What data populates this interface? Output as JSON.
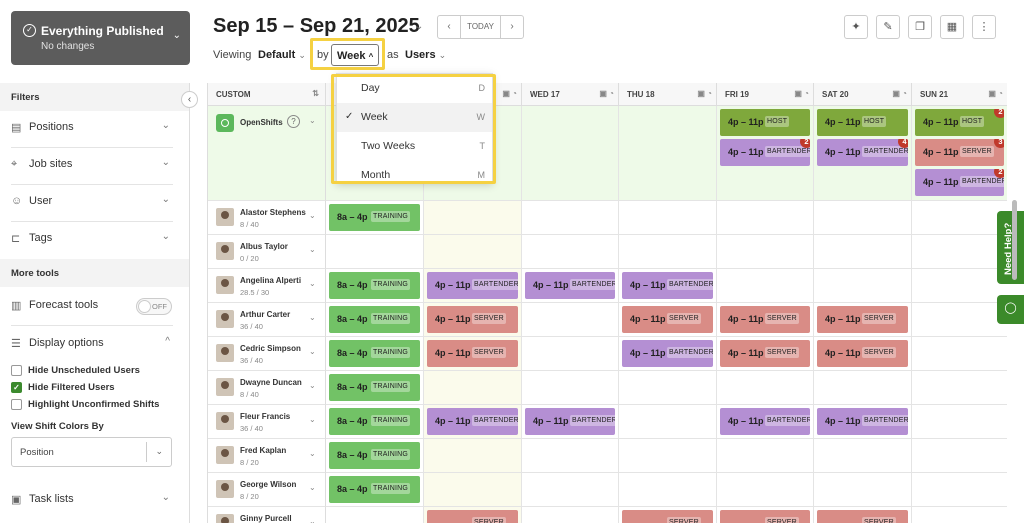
{
  "publish": {
    "title": "Everything Published",
    "subtitle": "No changes"
  },
  "header": {
    "date_range": "Sep 15 – Sep 21, 2025",
    "today_label": "TODAY",
    "prev_icon": "chevron-left-icon",
    "next_icon": "chevron-right-icon",
    "viewing_label": "Viewing",
    "viewing_value": "Default",
    "by_label": "by",
    "by_value": "Week",
    "as_label": "as",
    "as_value": "Users"
  },
  "toolbar_icons": [
    "sparkle-icon",
    "edit-icon",
    "copy-icon",
    "calendar-icon",
    "more-icon"
  ],
  "sidebar": {
    "filters_label": "Filters",
    "filters": [
      {
        "label": "Positions",
        "icon": "positions-icon"
      },
      {
        "label": "Job sites",
        "icon": "location-icon"
      },
      {
        "label": "User",
        "icon": "user-icon"
      },
      {
        "label": "Tags",
        "icon": "tag-icon"
      }
    ],
    "more_tools_label": "More tools",
    "forecast_label": "Forecast tools",
    "forecast_toggle": "OFF",
    "display_label": "Display options",
    "display_options": [
      {
        "label": "Hide Unscheduled Users",
        "checked": false
      },
      {
        "label": "Hide Filtered Users",
        "checked": true
      },
      {
        "label": "Highlight Unconfirmed Shifts",
        "checked": false
      }
    ],
    "shift_colors_label": "View Shift Colors By",
    "shift_colors_value": "Position",
    "task_lists_label": "Task lists"
  },
  "dropdown": {
    "items": [
      {
        "label": "Day",
        "key": "D",
        "selected": false
      },
      {
        "label": "Week",
        "key": "W",
        "selected": true
      },
      {
        "label": "Two Weeks",
        "key": "T",
        "selected": false
      },
      {
        "label": "Month",
        "key": "M",
        "selected": false
      }
    ]
  },
  "grid": {
    "first_col_label": "CUSTOM",
    "days": [
      "WED 17",
      "THU 18",
      "FRI 19",
      "SAT 20",
      "SUN 21"
    ],
    "openshifts_label": "OpenShifts",
    "openshifts": [
      {
        "day": 4,
        "row": 0,
        "time": "4p – 11p",
        "tag": "HOST",
        "color": "#7fa83c"
      },
      {
        "day": 5,
        "row": 0,
        "time": "4p – 11p",
        "tag": "HOST",
        "color": "#7fa83c"
      },
      {
        "day": 6,
        "row": 0,
        "time": "4p – 11p",
        "tag": "HOST",
        "color": "#7fa83c",
        "badge": "2"
      },
      {
        "day": 4,
        "row": 1,
        "time": "4p – 11p",
        "tag": "BARTENDER",
        "color": "#b48fd3",
        "badge": "2"
      },
      {
        "day": 5,
        "row": 1,
        "time": "4p – 11p",
        "tag": "BARTENDER",
        "color": "#b48fd3",
        "badge": "4"
      },
      {
        "day": 6,
        "row": 1,
        "time": "4p – 11p",
        "tag": "SERVER",
        "color": "#d98c86",
        "badge": "3"
      },
      {
        "day": 6,
        "row": 2,
        "time": "4p – 11p",
        "tag": "BARTENDER",
        "color": "#b48fd3",
        "badge": "2"
      }
    ],
    "users": [
      {
        "name": "Alastor Stephens",
        "hours": "8 / 40",
        "shifts": [
          {
            "day": 0,
            "time": "8a – 4p",
            "tag": "TRAINING",
            "type": "t"
          }
        ]
      },
      {
        "name": "Albus Taylor",
        "hours": "0 / 20",
        "shifts": []
      },
      {
        "name": "Angelina Alperti",
        "hours": "28.5 / 30",
        "shifts": [
          {
            "day": 0,
            "time": "8a – 4p",
            "tag": "TRAINING",
            "type": "t"
          },
          {
            "day": 1,
            "time": "4p – 11p",
            "tag": "BARTENDER",
            "type": "b"
          },
          {
            "day": 2,
            "time": "4p – 11p",
            "tag": "BARTENDER",
            "type": "b"
          },
          {
            "day": 3,
            "time": "4p – 11p",
            "tag": "BARTENDER",
            "type": "b"
          }
        ]
      },
      {
        "name": "Arthur Carter",
        "hours": "36 / 40",
        "shifts": [
          {
            "day": 0,
            "time": "8a – 4p",
            "tag": "TRAINING",
            "type": "t"
          },
          {
            "day": 1,
            "time": "4p – 11p",
            "tag": "SERVER",
            "type": "s"
          },
          {
            "day": 3,
            "time": "4p – 11p",
            "tag": "SERVER",
            "type": "s"
          },
          {
            "day": 4,
            "time": "4p – 11p",
            "tag": "SERVER",
            "type": "s"
          },
          {
            "day": 5,
            "time": "4p – 11p",
            "tag": "SERVER",
            "type": "s"
          }
        ]
      },
      {
        "name": "Cedric Simpson",
        "hours": "36 / 40",
        "shifts": [
          {
            "day": 0,
            "time": "8a – 4p",
            "tag": "TRAINING",
            "type": "t"
          },
          {
            "day": 1,
            "time": "4p – 11p",
            "tag": "SERVER",
            "type": "s"
          },
          {
            "day": 3,
            "time": "4p – 11p",
            "tag": "BARTENDER",
            "type": "b"
          },
          {
            "day": 4,
            "time": "4p – 11p",
            "tag": "SERVER",
            "type": "s"
          },
          {
            "day": 5,
            "time": "4p – 11p",
            "tag": "SERVER",
            "type": "s"
          }
        ]
      },
      {
        "name": "Dwayne Duncan",
        "hours": "8 / 40",
        "shifts": [
          {
            "day": 0,
            "time": "8a – 4p",
            "tag": "TRAINING",
            "type": "t"
          }
        ]
      },
      {
        "name": "Fleur Francis",
        "hours": "36 / 40",
        "shifts": [
          {
            "day": 0,
            "time": "8a – 4p",
            "tag": "TRAINING",
            "type": "t"
          },
          {
            "day": 1,
            "time": "4p – 11p",
            "tag": "BARTENDER",
            "type": "b"
          },
          {
            "day": 2,
            "time": "4p – 11p",
            "tag": "BARTENDER",
            "type": "b"
          },
          {
            "day": 4,
            "time": "4p – 11p",
            "tag": "BARTENDER",
            "type": "b"
          },
          {
            "day": 5,
            "time": "4p – 11p",
            "tag": "BARTENDER",
            "type": "b"
          }
        ]
      },
      {
        "name": "Fred Kaplan",
        "hours": "8 / 20",
        "shifts": [
          {
            "day": 0,
            "time": "8a – 4p",
            "tag": "TRAINING",
            "type": "t"
          }
        ]
      },
      {
        "name": "George Wilson",
        "hours": "8 / 20",
        "shifts": [
          {
            "day": 0,
            "time": "8a – 4p",
            "tag": "TRAINING",
            "type": "t"
          }
        ]
      },
      {
        "name": "Ginny Purcell",
        "hours": "",
        "shifts": [
          {
            "day": 1,
            "time": "",
            "tag": "SERVER",
            "type": "s"
          },
          {
            "day": 3,
            "time": "",
            "tag": "SERVER",
            "type": "s"
          },
          {
            "day": 4,
            "time": "",
            "tag": "SERVER",
            "type": "s"
          },
          {
            "day": 5,
            "time": "",
            "tag": "SERVER",
            "type": "s"
          }
        ]
      }
    ]
  },
  "colors": {
    "training": "#72c266",
    "bartender": "#b48fd3",
    "server": "#d98c86",
    "host": "#7fa83c",
    "openshift_bg": "#eefae8",
    "highlight": "#f5d142"
  },
  "help": {
    "label": "Need Help?",
    "chat_icon": "chat-icon"
  }
}
